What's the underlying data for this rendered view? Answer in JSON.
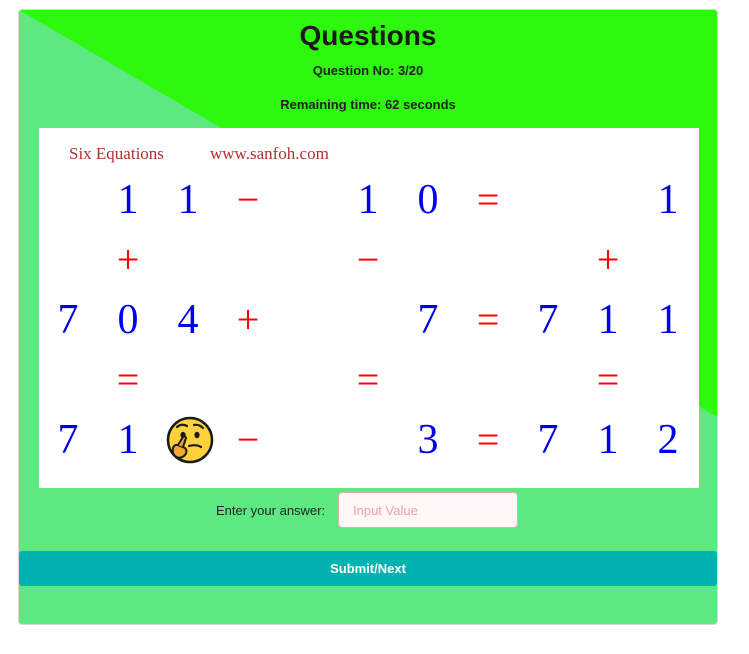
{
  "header": {
    "title": "Questions",
    "question_no": "Question No: 3/20",
    "remaining_time": "Remaining time: 62 seconds"
  },
  "puzzle": {
    "brand": "Six Equations",
    "site": "www.sanfoh.com",
    "rows": [
      [
        "1",
        "1",
        "−",
        "1",
        "0",
        "=",
        "1"
      ],
      [
        "+",
        "−",
        "+"
      ],
      [
        "7",
        "0",
        "4",
        "+",
        "7",
        "=",
        "7",
        "1",
        "1"
      ],
      [
        "=",
        "=",
        "="
      ],
      [
        "7",
        "1",
        "?",
        "−",
        "3",
        "=",
        "7",
        "1",
        "2"
      ]
    ],
    "unknown_icon": "thinking-face-icon"
  },
  "answer": {
    "label": "Enter your answer:",
    "placeholder": "Input Value",
    "value": ""
  },
  "submit_label": "Submit/Next",
  "colors": {
    "background_light": "#5de882",
    "background_bright": "#2ef80e",
    "number": "#0000ee",
    "operator": "#ff0000",
    "button": "#00b3b0"
  }
}
